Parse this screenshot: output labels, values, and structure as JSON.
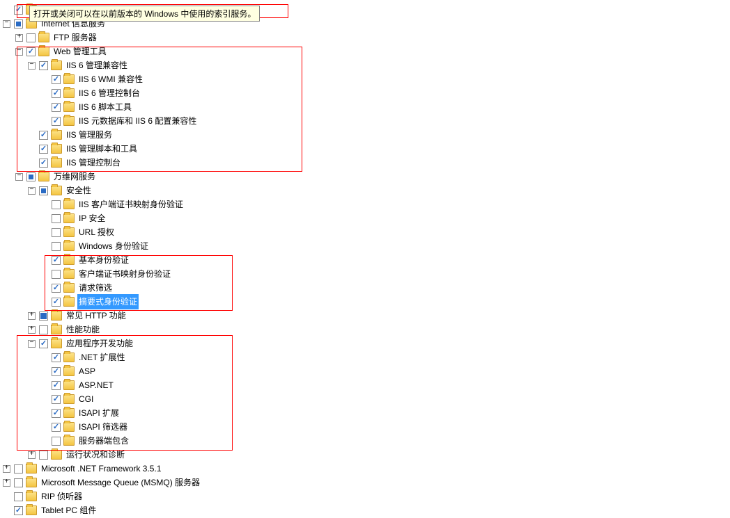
{
  "tooltip": "打开或关闭可以在以前版本的 Windows 中使用的索引服务。",
  "tree": [
    {
      "d": 0,
      "t": "",
      "c": "checked",
      "l": ""
    },
    {
      "d": 0,
      "t": "-",
      "c": "partial",
      "l": "Internet 信息服务"
    },
    {
      "d": 1,
      "t": "+",
      "c": "",
      "l": "FTP 服务器"
    },
    {
      "d": 1,
      "t": "-",
      "c": "checked",
      "l": "Web 管理工具"
    },
    {
      "d": 2,
      "t": "-",
      "c": "checked",
      "l": "IIS 6 管理兼容性"
    },
    {
      "d": 3,
      "t": "",
      "c": "checked",
      "l": "IIS 6 WMI 兼容性"
    },
    {
      "d": 3,
      "t": "",
      "c": "checked",
      "l": "IIS 6 管理控制台"
    },
    {
      "d": 3,
      "t": "",
      "c": "checked",
      "l": "IIS 6 脚本工具"
    },
    {
      "d": 3,
      "t": "",
      "c": "checked",
      "l": "IIS 元数据库和 IIS 6 配置兼容性"
    },
    {
      "d": 2,
      "t": "",
      "c": "checked",
      "l": "IIS 管理服务"
    },
    {
      "d": 2,
      "t": "",
      "c": "checked",
      "l": "IIS 管理脚本和工具"
    },
    {
      "d": 2,
      "t": "",
      "c": "checked",
      "l": "IIS 管理控制台"
    },
    {
      "d": 1,
      "t": "-",
      "c": "partial",
      "l": "万维网服务"
    },
    {
      "d": 2,
      "t": "-",
      "c": "partial",
      "l": "安全性"
    },
    {
      "d": 3,
      "t": "",
      "c": "",
      "l": "IIS 客户端证书映射身份验证"
    },
    {
      "d": 3,
      "t": "",
      "c": "",
      "l": "IP 安全"
    },
    {
      "d": 3,
      "t": "",
      "c": "",
      "l": "URL 授权"
    },
    {
      "d": 3,
      "t": "",
      "c": "",
      "l": "Windows 身份验证"
    },
    {
      "d": 3,
      "t": "",
      "c": "checked",
      "l": "基本身份验证"
    },
    {
      "d": 3,
      "t": "",
      "c": "",
      "l": "客户端证书映射身份验证"
    },
    {
      "d": 3,
      "t": "",
      "c": "checked",
      "l": "请求筛选"
    },
    {
      "d": 3,
      "t": "",
      "c": "checked",
      "l": "摘要式身份验证",
      "sel": true
    },
    {
      "d": 2,
      "t": "+",
      "c": "filled",
      "l": "常见 HTTP 功能"
    },
    {
      "d": 2,
      "t": "+",
      "c": "",
      "l": "性能功能"
    },
    {
      "d": 2,
      "t": "-",
      "c": "checked",
      "l": "应用程序开发功能"
    },
    {
      "d": 3,
      "t": "",
      "c": "checked",
      "l": ".NET 扩展性"
    },
    {
      "d": 3,
      "t": "",
      "c": "checked",
      "l": "ASP"
    },
    {
      "d": 3,
      "t": "",
      "c": "checked",
      "l": "ASP.NET"
    },
    {
      "d": 3,
      "t": "",
      "c": "checked",
      "l": "CGI"
    },
    {
      "d": 3,
      "t": "",
      "c": "checked",
      "l": "ISAPI 扩展"
    },
    {
      "d": 3,
      "t": "",
      "c": "checked",
      "l": "ISAPI 筛选器"
    },
    {
      "d": 3,
      "t": "",
      "c": "",
      "l": "服务器端包含"
    },
    {
      "d": 2,
      "t": "+",
      "c": "",
      "l": "运行状况和诊断"
    },
    {
      "d": 0,
      "t": "+",
      "c": "",
      "l": "Microsoft .NET Framework 3.5.1"
    },
    {
      "d": 0,
      "t": "+",
      "c": "",
      "l": "Microsoft Message Queue (MSMQ) 服务器"
    },
    {
      "d": 0,
      "t": "",
      "c": "",
      "l": "RIP 侦听器"
    },
    {
      "d": 0,
      "t": "",
      "c": "checked",
      "l": "Tablet PC 组件"
    }
  ]
}
